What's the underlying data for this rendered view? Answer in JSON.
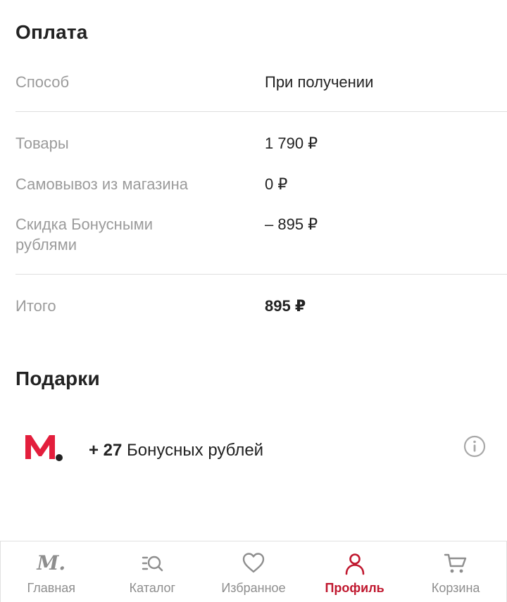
{
  "payment": {
    "title": "Оплата",
    "method_label": "Способ",
    "method_value": "При получении"
  },
  "summary": {
    "goods_label": "Товары",
    "goods_value": "1 790 ₽",
    "pickup_label": "Самовывоз из магазина",
    "pickup_value": "0 ₽",
    "discount_label": "Скидка Бонусными рублями",
    "discount_value": "– 895 ₽",
    "total_label": "Итого",
    "total_value": "895 ₽"
  },
  "gifts": {
    "title": "Подарки",
    "bonus_amount": "+ 27",
    "bonus_text": " Бонусных рублей",
    "logo_icon": "mvideo-logo-icon",
    "info_icon": "info-icon"
  },
  "colors": {
    "accent": "#c0182f",
    "logo_red": "#e31e3c",
    "muted": "#9b9b9b"
  },
  "tabbar": {
    "tabs": [
      {
        "label": "Главная",
        "icon": "m-logo-icon",
        "active": false,
        "glyph": "M."
      },
      {
        "label": "Каталог",
        "icon": "catalog-search-icon",
        "active": false
      },
      {
        "label": "Избранное",
        "icon": "heart-icon",
        "active": false
      },
      {
        "label": "Профиль",
        "icon": "profile-icon",
        "active": true
      },
      {
        "label": "Корзина",
        "icon": "cart-icon",
        "active": false
      }
    ]
  }
}
